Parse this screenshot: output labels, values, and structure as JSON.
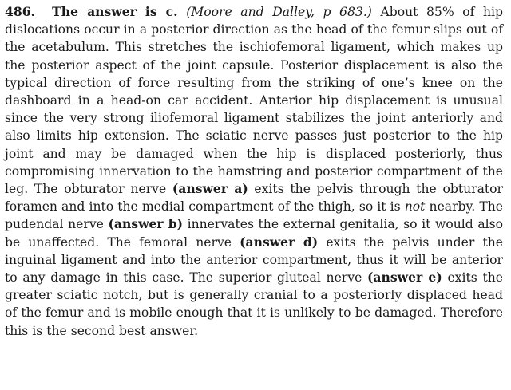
{
  "question": {
    "number": "486.",
    "answer_head": "The answer is c.",
    "citation": "(Moore and Dalley, p 683.)"
  },
  "body": {
    "s1": " About 85% of hip dislocations occur in a posterior direction as the head of the femur slips out of the acetabulum. This stretches the ischiofemoral ligament, which makes up the posterior aspect of the joint capsule. Posterior displacement is also the typical direction of force resulting from the striking of one’s knee on the dashboard in a head-on car accident. Anterior hip displacement is unusual since the very strong iliofemoral ligament stabilizes the joint anteriorly and also limits hip extension. The sciatic nerve passes just posterior to the hip joint and may be damaged when the hip is displaced posteriorly, thus compromising innervation to the hamstring and posterior compartment of the leg. The obturator nerve ",
    "ref_a": "(answer a)",
    "s2": " exits the pelvis through the obturator foramen and into the medial compartment of the thigh, so it is ",
    "not_word": "not",
    "s3": " nearby. The pudendal nerve ",
    "ref_b": "(answer b)",
    "s4": " innervates the external genitalia, so it would also be unaffected. The femoral nerve ",
    "ref_d": "(answer d)",
    "s5": " exits the pelvis under the inguinal ligament and into the anterior compartment, thus it will be anterior to any damage in this case. The superior gluteal nerve ",
    "ref_e": "(answer e)",
    "s6": " exits the greater sciatic notch, but is generally cranial to a posteriorly displaced head of the femur and is mobile enough that it is unlikely to be damaged. Therefore this is the second best answer."
  }
}
